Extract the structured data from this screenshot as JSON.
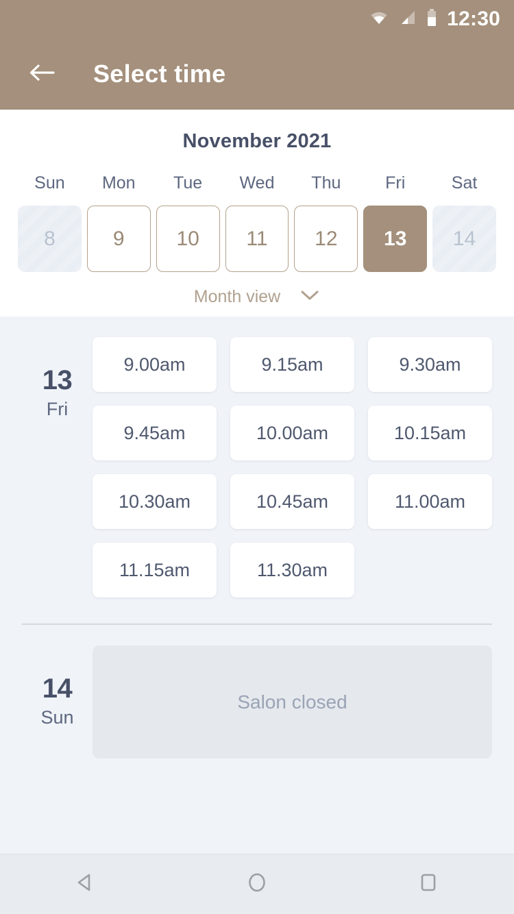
{
  "statusbar": {
    "time": "12:30",
    "icons": [
      "wifi-icon",
      "cellular-signal-icon",
      "battery-icon"
    ]
  },
  "appbar": {
    "title": "Select time",
    "back_icon": "arrow-left-icon"
  },
  "calendar": {
    "month_title": "November 2021",
    "weekdays": [
      "Sun",
      "Mon",
      "Tue",
      "Wed",
      "Thu",
      "Fri",
      "Sat"
    ],
    "days": [
      {
        "number": "8",
        "state": "disabled"
      },
      {
        "number": "9",
        "state": "available"
      },
      {
        "number": "10",
        "state": "available"
      },
      {
        "number": "11",
        "state": "available"
      },
      {
        "number": "12",
        "state": "available"
      },
      {
        "number": "13",
        "state": "selected"
      },
      {
        "number": "14",
        "state": "disabled"
      }
    ],
    "month_view_label": "Month view",
    "month_view_icon": "chevron-down-icon"
  },
  "schedule": [
    {
      "day_number": "13",
      "day_name": "Fri",
      "slots": [
        "9.00am",
        "9.15am",
        "9.30am",
        "9.45am",
        "10.00am",
        "10.15am",
        "10.30am",
        "10.45am",
        "11.00am",
        "11.15am",
        "11.30am"
      ]
    },
    {
      "day_number": "14",
      "day_name": "Sun",
      "closed_message": "Salon closed"
    }
  ],
  "navbar": {
    "back_icon": "nav-back-triangle-icon",
    "home_icon": "nav-home-circle-icon",
    "recents_icon": "nav-recents-square-icon"
  },
  "colors": {
    "brand_tan": "#a4907c",
    "page_background": "#f0f3f8",
    "slot_text": "#4f586e",
    "heading": "#475067",
    "closed_panel": "#e5e8ed"
  }
}
